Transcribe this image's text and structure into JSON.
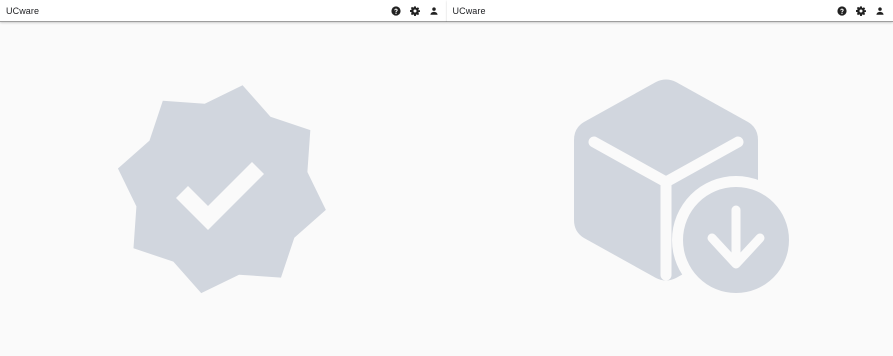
{
  "panels": [
    {
      "header": {
        "brand": "UCware",
        "icons": [
          "help-icon",
          "settings-icon",
          "account-icon"
        ]
      },
      "illustration": "verified-badge-icon"
    },
    {
      "header": {
        "brand": "UCware",
        "icons": [
          "help-icon",
          "settings-icon",
          "account-icon"
        ]
      },
      "illustration": "package-download-icon"
    }
  ],
  "colors": {
    "illustration": "#d1d6de",
    "topbar_bg": "#ffffff",
    "page_bg": "#fafafa",
    "icon": "#212121"
  }
}
